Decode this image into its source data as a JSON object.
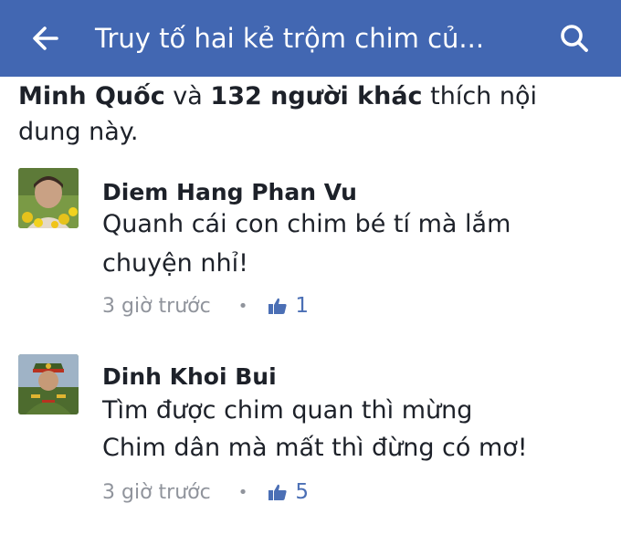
{
  "header": {
    "title": "Truy tố hai kẻ trộm chim củ...",
    "back_icon": "arrow-left-icon",
    "search_icon": "search-icon",
    "bar_color": "#4267b2"
  },
  "likes": {
    "name": "Minh Quốc",
    "connector": " và ",
    "others": "132 người khác",
    "suffix": " thích nội dung này."
  },
  "comments": [
    {
      "author": "Diem Hang Phan Vu",
      "lines": [
        "Quanh cái con chim bé tí mà lắm",
        "chuyện nhỉ!"
      ],
      "time": "3 giờ trước",
      "like_count": "1"
    },
    {
      "author": "Dinh Khoi Bui",
      "lines": [
        "Tìm được chim quan thì mừng",
        "Chim dân mà mất thì đừng có mơ!"
      ],
      "time": "3 giờ trước",
      "like_count": "5"
    }
  ],
  "colors": {
    "like_blue": "#4b6fb5",
    "meta_gray": "#90949c",
    "text": "#1d2129"
  }
}
